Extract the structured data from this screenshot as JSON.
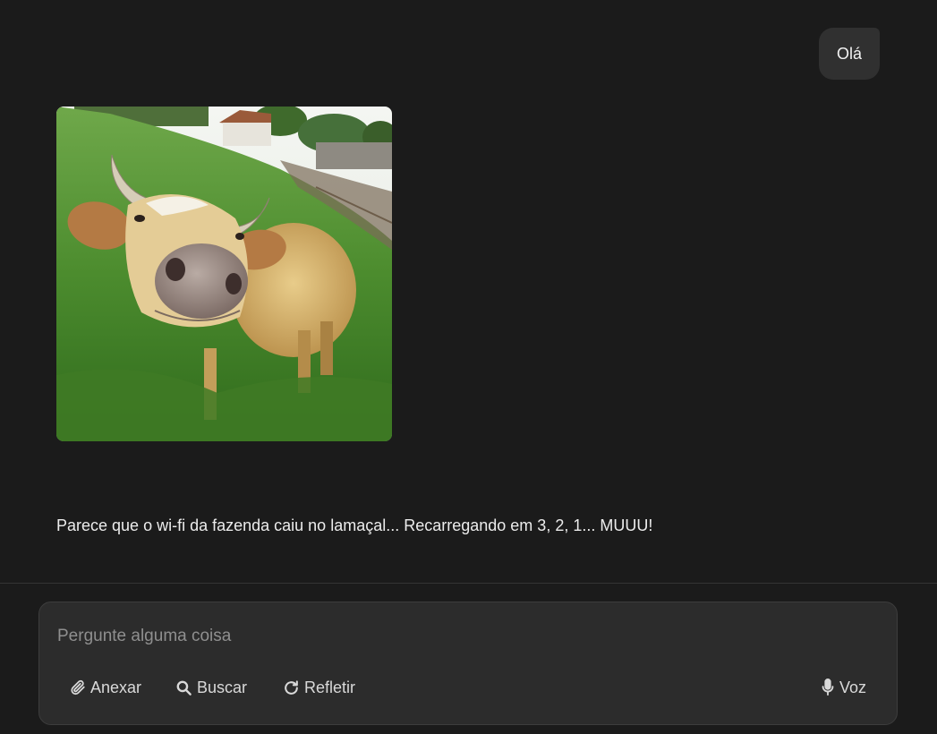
{
  "chat": {
    "user_message": "Olá",
    "assistant_image_alt": "cow-photo",
    "assistant_message": "Parece que o wi-fi da fazenda caiu no lamaçal... Recarregando em 3, 2, 1... MUUU!"
  },
  "composer": {
    "placeholder": "Pergunte alguma coisa",
    "value": "",
    "attach_label": "Anexar",
    "attach_icon": "paperclip-icon",
    "search_label": "Buscar",
    "search_icon": "search-icon",
    "reflect_label": "Refletir",
    "reflect_icon": "refresh-icon",
    "voice_label": "Voz",
    "voice_icon": "microphone-icon"
  },
  "colors": {
    "background": "#1b1b1b",
    "bubble": "#303030",
    "composer": "#2c2c2c"
  }
}
